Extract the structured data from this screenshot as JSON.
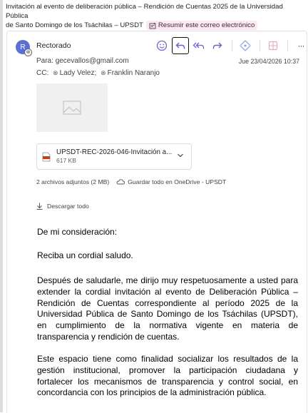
{
  "subject": {
    "line1": "Invitación al evento de deliberación pública – Rendición de Cuentas 2025 de la Universidad Pública",
    "line2": "de Santo Domingo de los Tsáchilas – UPSDT",
    "summarize_label": "Resumir este correo electrónico"
  },
  "message": {
    "avatar_initial": "R",
    "sender": "Rectorado",
    "to_label": "Para:",
    "to": "gecevallos@gmail.com",
    "date": "Jue 23/04/2026 10:37",
    "cc_label": "CC:",
    "cc": [
      "Lady Velez;",
      "Franklin Naranjo"
    ]
  },
  "toolbar": {
    "icons": [
      "emoji-icon",
      "reply-icon",
      "reply-all-icon",
      "forward-icon",
      "loop-icon",
      "apps-icon",
      "more-icon"
    ],
    "more_label": "···"
  },
  "attachments": {
    "file_name": "UPSDT-REC-2026-046-Invitación a...",
    "file_size": "617 KB",
    "summary": "2 archivos adjuntos (2 MB)",
    "save_label": "Guardar todo en OneDrive - UPSDT",
    "download_label": "Descargar todo"
  },
  "body": {
    "greeting": "De mi consideración:",
    "salutation": "Reciba un cordial saludo.",
    "paragraph1": "Después de saludarle, me dirijo muy respetuosamente a usted para extender la cordial invitación al evento de Deliberación Pública – Rendición de Cuentas correspondiente al período 2025 de la Universidad Pública de Santo Domingo de los Tsáchilas (UPSDT), en cumplimiento de la normativa vigente en materia de transparencia y rendición de cuentas.",
    "paragraph2": "Este espacio tiene como finalidad socializar los resultados de la gestión institucional, promover la participación ciudadana y fortalecer los mecanismos de transparencia y control social, en concordancia con los principios de la administración pública."
  },
  "colors": {
    "avatar": "#5b6fd6",
    "summarize_bg": "#fde7f3",
    "reply_icon": "#6b5fcf",
    "pdf_icon": "#c43e1c"
  }
}
